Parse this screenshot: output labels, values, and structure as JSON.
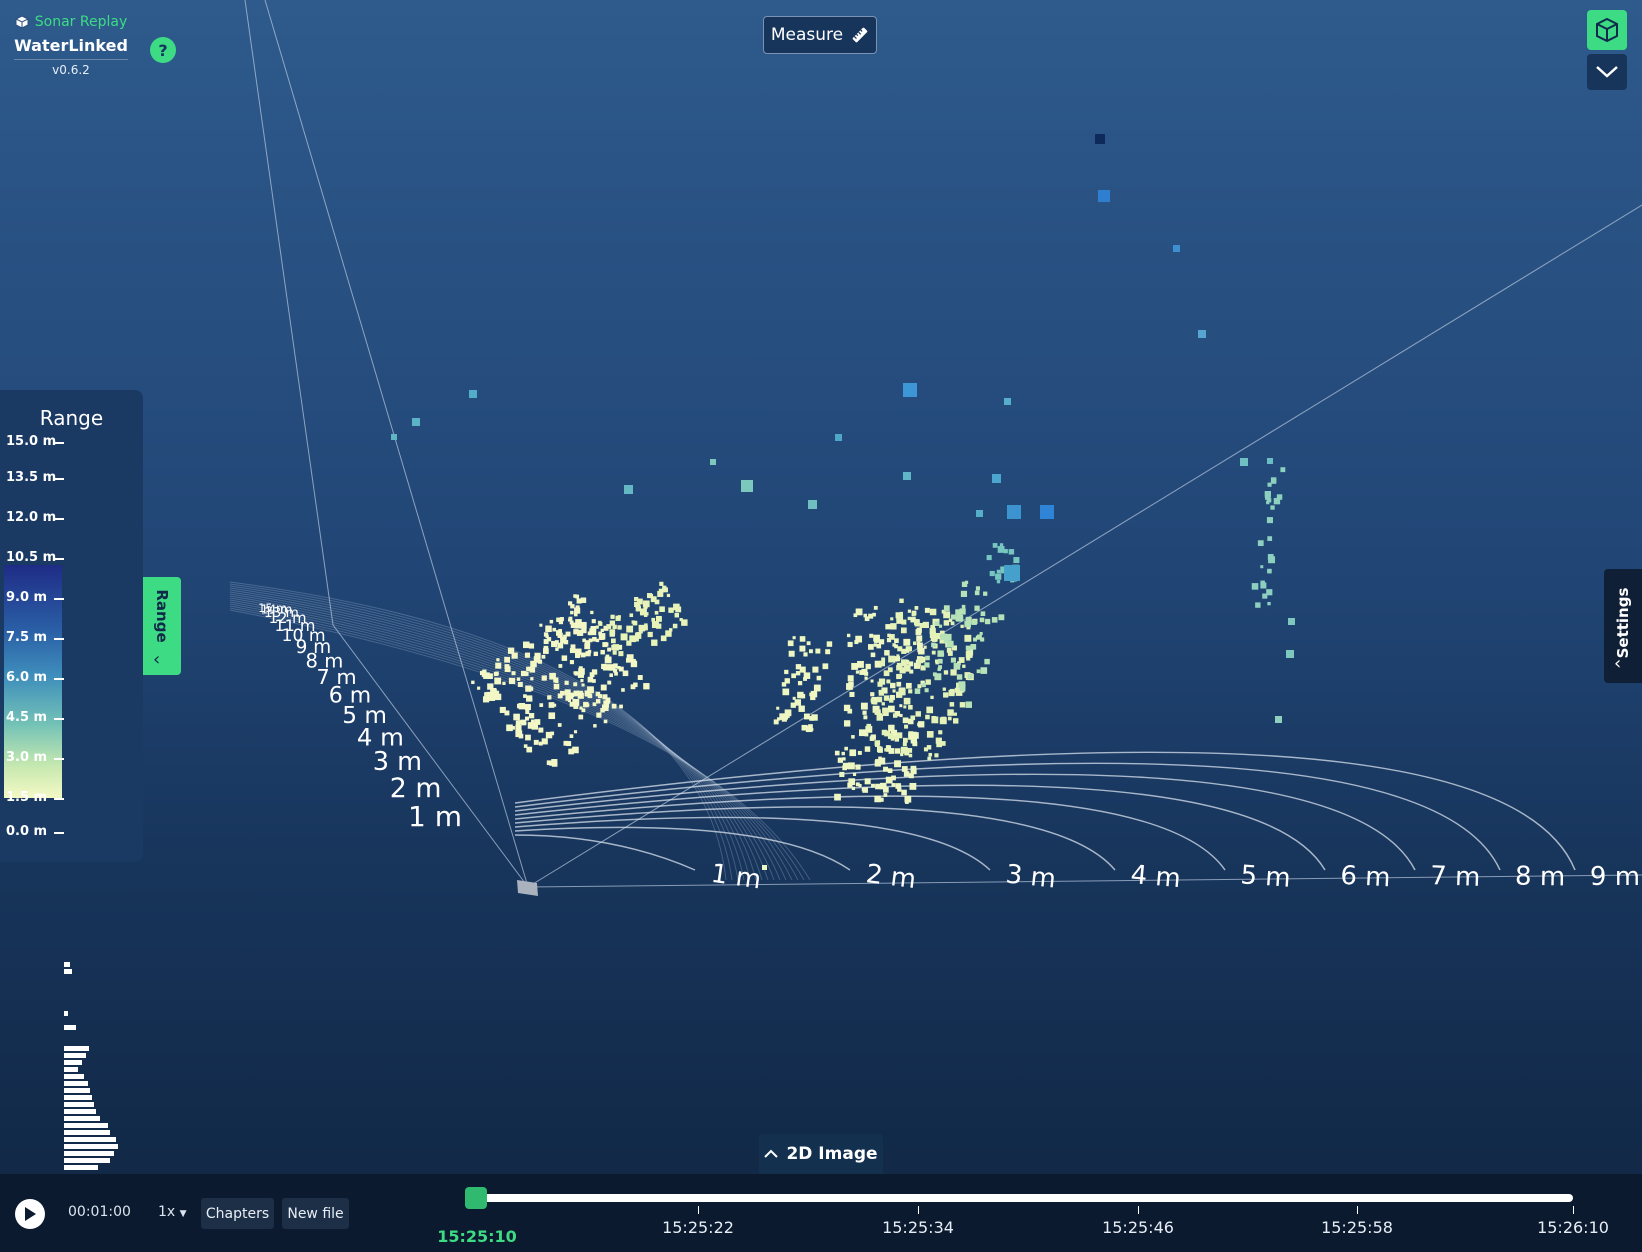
{
  "app": {
    "name": "Sonar Replay",
    "logo_text": "WaterLinked",
    "version": "v0.6.2",
    "help_label": "?"
  },
  "toolbar": {
    "measure_label": "Measure"
  },
  "view_controls": {
    "view_icon": "cube-icon",
    "more_icon": "chevron-down-icon"
  },
  "range_panel": {
    "title": "Range",
    "ticks": [
      "15.0 m",
      "13.5 m",
      "12.0 m",
      "10.5 m",
      "9.0 m",
      "7.5 m",
      "6.0 m",
      "4.5 m",
      "3.0 m",
      "1.5 m",
      "0.0 m"
    ],
    "tab_label": "Range",
    "histogram": [
      6,
      8,
      0,
      0,
      0,
      0,
      0,
      4,
      0,
      12,
      0,
      0,
      25,
      22,
      18,
      14,
      20,
      24,
      26,
      28,
      30,
      32,
      36,
      44,
      46,
      52,
      54,
      50,
      46,
      34
    ]
  },
  "settings_tab": {
    "label": "Settings"
  },
  "scene_labels": {
    "front_grid": [
      "1 m",
      "2 m",
      "3 m",
      "4 m",
      "5 m",
      "6 m",
      "7 m",
      "8 m",
      "9 m"
    ],
    "left_grid": [
      "1 m",
      "2 m",
      "3 m",
      "4 m",
      "5 m",
      "6 m",
      "7 m",
      "8 m",
      "9 m",
      "10 m",
      "11 m",
      "12 m",
      "13 m",
      "14 m",
      "15 m"
    ]
  },
  "image_2d": {
    "label": "2D Image"
  },
  "playback": {
    "elapsed": "00:01:00",
    "speed": "1x",
    "chapters_label": "Chapters",
    "new_file_label": "New file",
    "current_time": "15:25:10",
    "timeline_labels": [
      "15:25:22",
      "15:25:34",
      "15:25:46",
      "15:25:58",
      "15:26:10"
    ],
    "progress": 0.0
  },
  "colors": {
    "accent": "#3ddc84",
    "background_top": "#2e5a8c",
    "background_bottom": "#102642"
  }
}
